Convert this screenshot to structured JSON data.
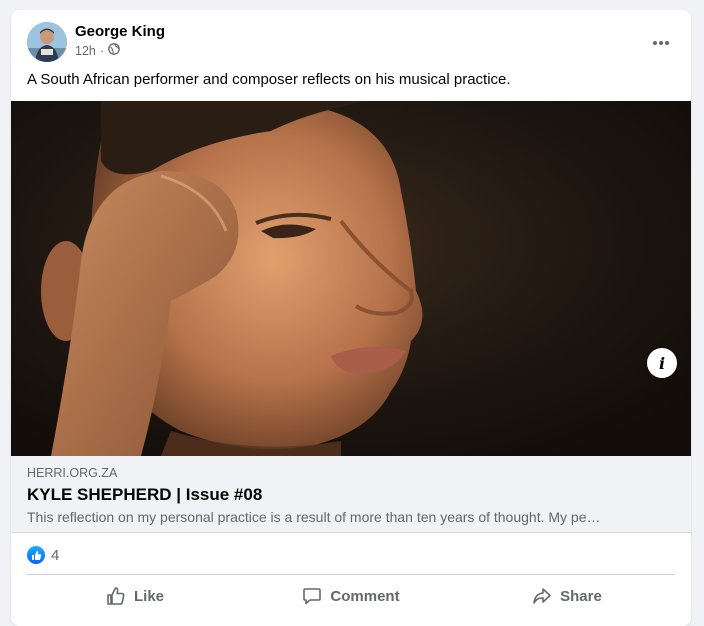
{
  "post": {
    "author": "George King",
    "time": "12h",
    "separator": "·",
    "privacy_icon": "globe-icon",
    "more_icon": "more-options-icon",
    "caption": "A South African performer and composer reflects on his musical practice."
  },
  "link_preview": {
    "domain": "HERRI.ORG.ZA",
    "title": "KYLE SHEPHERD | Issue #08",
    "description": "This reflection on my personal practice is a result of more than ten years of thought. My pe…",
    "info_label": "i"
  },
  "reactions": {
    "icon": "like-reaction-icon",
    "count": "4"
  },
  "actions": {
    "like": "Like",
    "comment": "Comment",
    "share": "Share"
  },
  "colors": {
    "accent": "#0866ff",
    "secondary_text": "#65676b",
    "background": "#f0f2f5"
  }
}
